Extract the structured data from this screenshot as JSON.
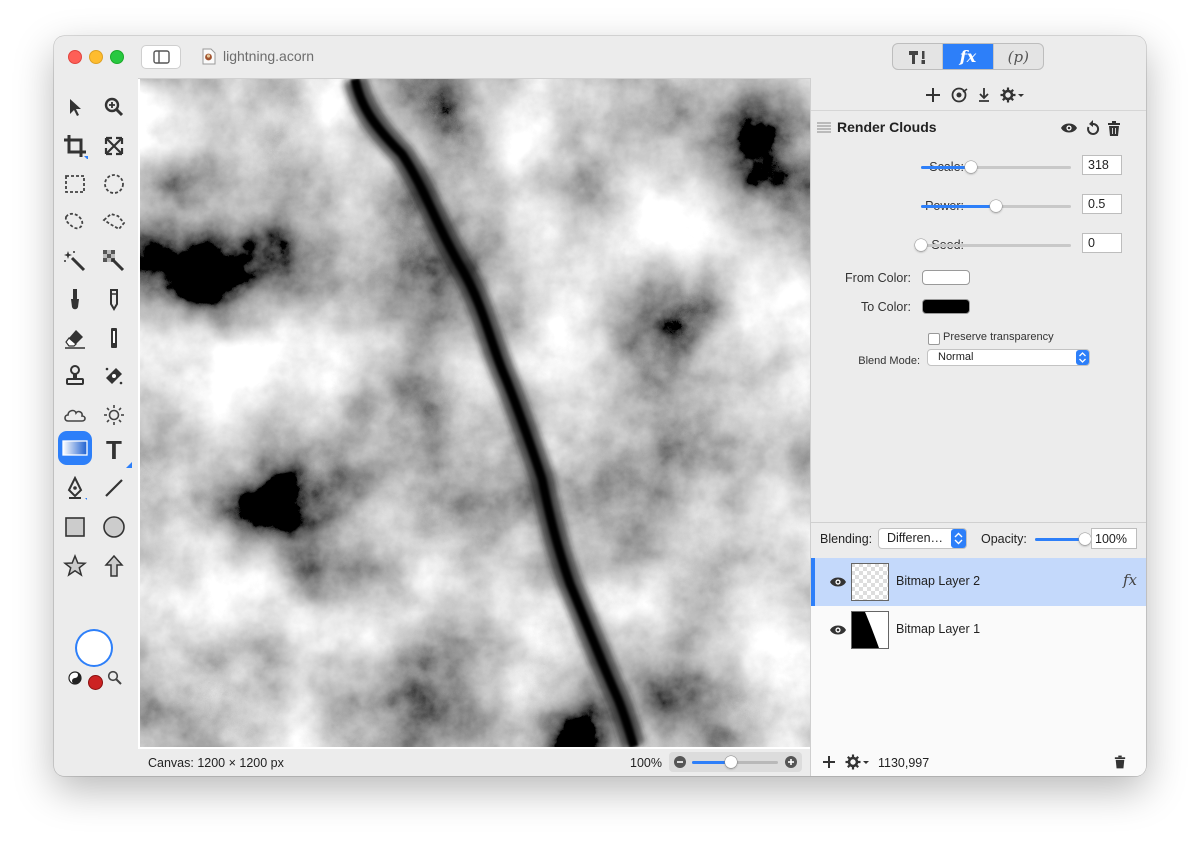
{
  "window": {
    "title": "lightning.acorn",
    "mode_tabs": [
      "tools",
      "fx",
      "p"
    ],
    "mode_tab_labels": {
      "fx": "fx",
      "p": "(p)"
    }
  },
  "toolbox": {
    "tools": [
      "select-arrow",
      "zoom",
      "crop",
      "transform",
      "rect-marquee",
      "ellipse-marquee",
      "lasso",
      "polygon-lasso",
      "magic-wand",
      "magic-wand-color",
      "brush",
      "pencil",
      "eraser",
      "smudge",
      "clone-stamp",
      "healing",
      "cloud-brush",
      "light-burn",
      "gradient",
      "text",
      "bezier-pen",
      "line",
      "rectangle",
      "oval",
      "star",
      "arrow"
    ],
    "selected_tool": "gradient",
    "text_tool_glyph": "T"
  },
  "filter": {
    "name": "Render Clouds",
    "params": [
      {
        "label": "Scale:",
        "value": "318",
        "fraction": 0.33
      },
      {
        "label": "Power:",
        "value": "0.5",
        "fraction": 0.5
      },
      {
        "label": "Seed:",
        "value": "0",
        "fraction": 0.0
      }
    ],
    "from_color_label": "From Color:",
    "to_color_label": "To Color:",
    "from_color": "#ffffff",
    "to_color": "#000000",
    "preserve_transparency_label": "Preserve transparency",
    "blend_mode_label": "Blend Mode:",
    "blend_mode_value": "Normal"
  },
  "layers": {
    "blending_label": "Blending:",
    "blending_value": "Differen…",
    "opacity_label": "Opacity:",
    "opacity_value": "100%",
    "opacity_fraction": 1.0,
    "items": [
      {
        "name": "Bitmap Layer 2",
        "selected": true,
        "has_fx": true,
        "fx_label": "fx"
      },
      {
        "name": "Bitmap Layer 1",
        "selected": false,
        "has_fx": false
      }
    ]
  },
  "status": {
    "canvas_size": "Canvas: 1200 × 1200 px",
    "zoom": "100%",
    "zoom_fraction": 0.45,
    "cursor_coords": "1130,997"
  },
  "colors": {
    "accent": "#2d7ff9",
    "selection_row": "#c4d9fb",
    "close": "#fe5f57",
    "minimize": "#febc2e",
    "maximize": "#28c840"
  }
}
